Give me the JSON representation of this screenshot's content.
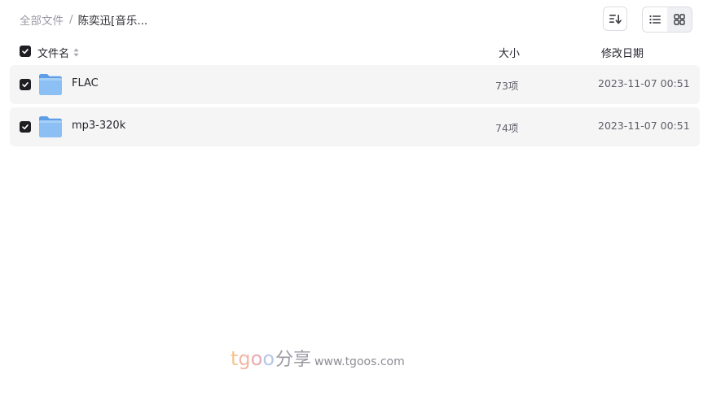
{
  "breadcrumb": {
    "root": "全部文件",
    "separator": "/",
    "current": "陈奕迅[音乐..."
  },
  "toolbar": {
    "sort_icon": "sort-icon",
    "view_list_icon": "list-view-icon",
    "view_grid_icon": "grid-view-icon",
    "active_view": "list"
  },
  "table": {
    "headers": {
      "name": "文件名",
      "size": "大小",
      "date": "修改日期"
    },
    "select_all_checked": true,
    "rows": [
      {
        "name": "FLAC",
        "size": "73项",
        "date": "2023-11-07 00:51",
        "checked": true,
        "icon": "folder-icon"
      },
      {
        "name": "mp3-320k",
        "size": "74项",
        "date": "2023-11-07 00:51",
        "checked": true,
        "icon": "folder-icon"
      }
    ]
  },
  "watermark": {
    "t": "t",
    "g": "g",
    "o1": "o",
    "o2": "o",
    "cn": "分享",
    "url": "www.tgoos.com"
  },
  "colors": {
    "row_background": "#f5f5f6",
    "checkbox": "#1f1f23",
    "folder": "#7fb6f2",
    "muted_text": "#9a9aa3"
  }
}
